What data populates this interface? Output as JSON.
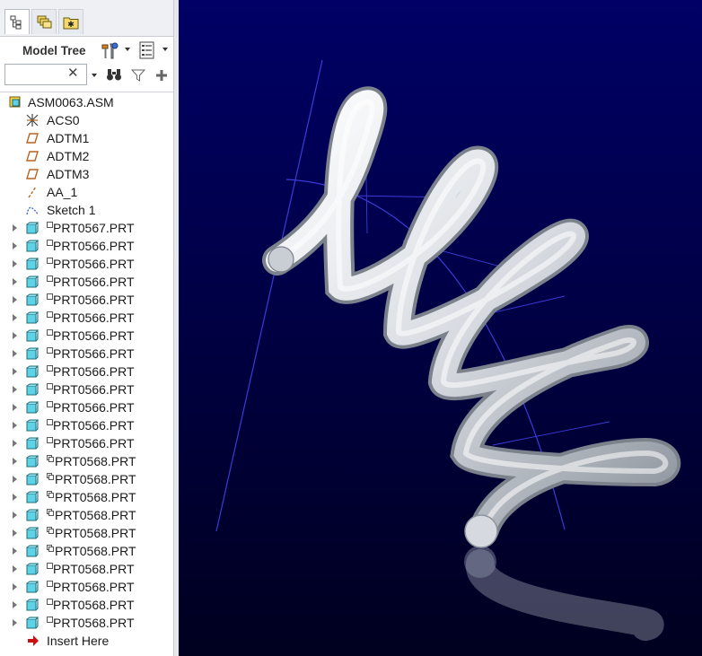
{
  "tabs": [
    {
      "name": "model-tree-tab-icon",
      "active": true
    },
    {
      "name": "layers-tab-icon",
      "active": false
    },
    {
      "name": "favorites-tab-icon",
      "active": false
    }
  ],
  "header": {
    "title": "Model Tree",
    "settings_icon": "tools-icon",
    "show_icon": "tree-columns-icon"
  },
  "search": {
    "value": "",
    "clear_glyph": "✕"
  },
  "tree": {
    "root": {
      "label": "ASM0063.ASM",
      "icon": "assembly-icon"
    },
    "features": [
      {
        "label": "ACS0",
        "icon": "coordinate-system-icon"
      },
      {
        "label": "ADTM1",
        "icon": "datum-plane-icon"
      },
      {
        "label": "ADTM2",
        "icon": "datum-plane-icon"
      },
      {
        "label": "ADTM3",
        "icon": "datum-plane-icon"
      },
      {
        "label": "AA_1",
        "icon": "datum-axis-icon"
      },
      {
        "label": "Sketch 1",
        "icon": "sketch-icon"
      }
    ],
    "parts": [
      {
        "label": "PRT0567.PRT",
        "marker": "single"
      },
      {
        "label": "PRT0566.PRT",
        "marker": "single"
      },
      {
        "label": "PRT0566.PRT",
        "marker": "single"
      },
      {
        "label": "PRT0566.PRT",
        "marker": "single"
      },
      {
        "label": "PRT0566.PRT",
        "marker": "single"
      },
      {
        "label": "PRT0566.PRT",
        "marker": "single"
      },
      {
        "label": "PRT0566.PRT",
        "marker": "single"
      },
      {
        "label": "PRT0566.PRT",
        "marker": "single"
      },
      {
        "label": "PRT0566.PRT",
        "marker": "single"
      },
      {
        "label": "PRT0566.PRT",
        "marker": "single"
      },
      {
        "label": "PRT0566.PRT",
        "marker": "single"
      },
      {
        "label": "PRT0566.PRT",
        "marker": "single"
      },
      {
        "label": "PRT0566.PRT",
        "marker": "single"
      },
      {
        "label": "PRT0568.PRT",
        "marker": "double"
      },
      {
        "label": "PRT0568.PRT",
        "marker": "double"
      },
      {
        "label": "PRT0568.PRT",
        "marker": "double"
      },
      {
        "label": "PRT0568.PRT",
        "marker": "double"
      },
      {
        "label": "PRT0568.PRT",
        "marker": "double"
      },
      {
        "label": "PRT0568.PRT",
        "marker": "double"
      },
      {
        "label": "PRT0568.PRT",
        "marker": "single"
      },
      {
        "label": "PRT0568.PRT",
        "marker": "single"
      },
      {
        "label": "PRT0568.PRT",
        "marker": "single"
      },
      {
        "label": "PRT0568.PRT",
        "marker": "single"
      }
    ],
    "insert_here": {
      "label": "Insert Here",
      "icon": "insert-arrow-icon"
    }
  },
  "colors": {
    "viewport_top": "#000066",
    "viewport_bottom": "#000022",
    "part_icon": "#5fd3e6",
    "datum_plane": "#b5651d",
    "insert_arrow": "#cc1111",
    "spring": "#e9ecf0",
    "datum_lines": "#3b3bd6"
  }
}
